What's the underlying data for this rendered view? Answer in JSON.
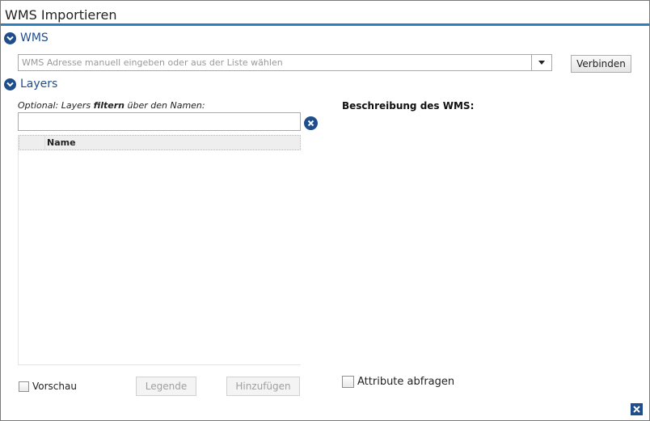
{
  "dialog": {
    "title": "WMS Importieren"
  },
  "wms_section": {
    "label": "WMS",
    "url_placeholder": "WMS Adresse manuell eingeben oder aus der Liste wählen",
    "url_value": "",
    "connect_label": "Verbinden"
  },
  "layers_section": {
    "label": "Layers",
    "filter_hint_prefix": "Optional: Layers ",
    "filter_hint_bold": "filtern",
    "filter_hint_suffix": " über den Namen:",
    "filter_value": "",
    "table": {
      "columns": [
        "",
        "Name"
      ],
      "rows": []
    },
    "description_label": "Beschreibung des WMS:"
  },
  "footer": {
    "preview_label": "Vorschau",
    "legend_label": "Legende",
    "add_label": "Hinzufügen",
    "attributes_label": "Attribute abfragen"
  },
  "icons": {
    "toggle": "chevron-down-circle-icon",
    "clear": "clear-circle-icon",
    "dropdown": "triangle-down-icon",
    "close": "close-icon"
  },
  "colors": {
    "accent": "#1f4e8c",
    "title_border": "#2a7fc1"
  }
}
